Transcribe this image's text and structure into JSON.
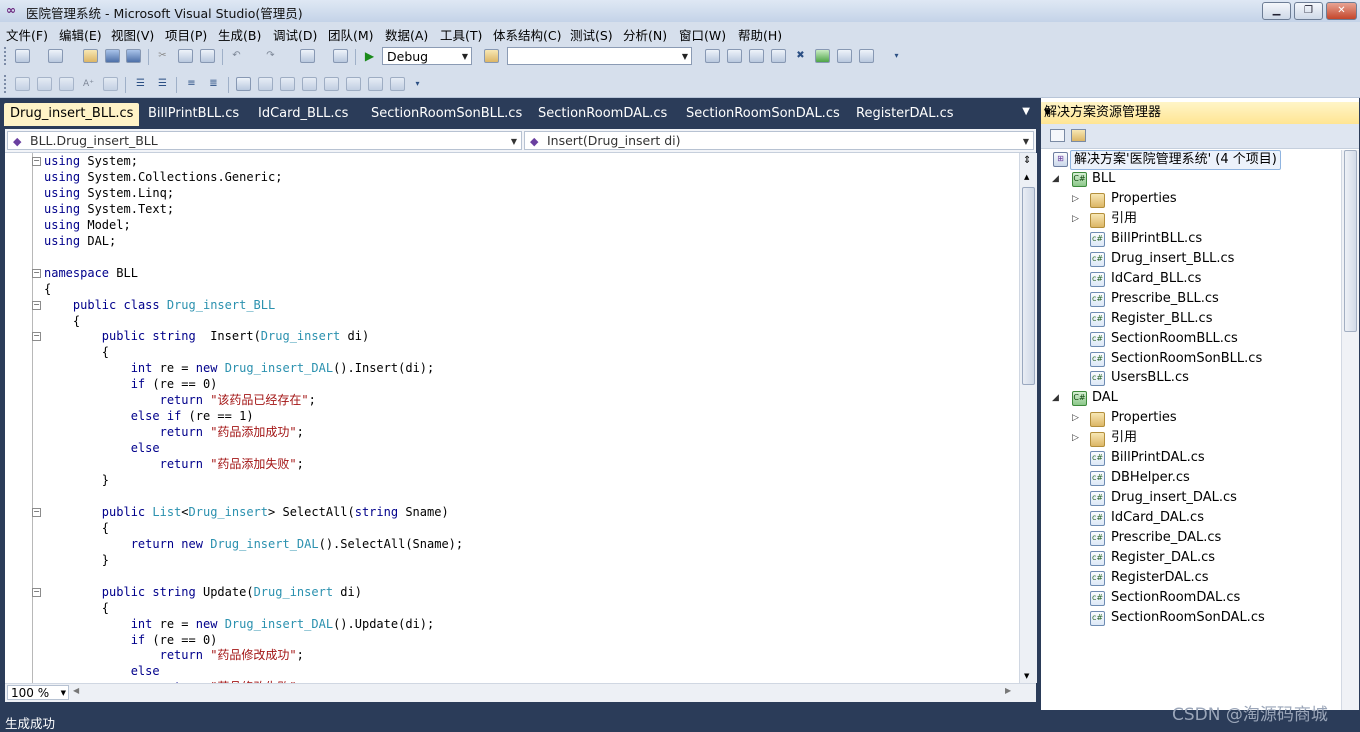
{
  "window": {
    "title": "医院管理系统 - Microsoft Visual Studio(管理员)",
    "buttons": [
      "▁",
      "❐",
      "✕"
    ]
  },
  "menu": [
    "文件(F)",
    "编辑(E)",
    "视图(V)",
    "项目(P)",
    "生成(B)",
    "调试(D)",
    "团队(M)",
    "数据(A)",
    "工具(T)",
    "体系结构(C)",
    "测试(S)",
    "分析(N)",
    "窗口(W)",
    "帮助(H)"
  ],
  "toolbar": {
    "configuration": "Debug",
    "platform": "",
    "start_icon": "play-icon"
  },
  "tabs": [
    "Drug_insert_BLL.cs",
    "BillPrintBLL.cs",
    "IdCard_BLL.cs",
    "SectionRoomSonBLL.cs",
    "SectionRoomDAL.cs",
    "SectionRoomSonDAL.cs",
    "RegisterDAL.cs"
  ],
  "navigation": {
    "type": "BLL.Drug_insert_BLL",
    "member": "Insert(Drug_insert di)"
  },
  "code_lines": [
    "using System;",
    "using System.Collections.Generic;",
    "using System.Linq;",
    "using System.Text;",
    "using Model;",
    "using DAL;",
    "",
    "namespace BLL",
    "{",
    "    public class Drug_insert_BLL",
    "    {",
    "        public string  Insert(Drug_insert di)",
    "        {",
    "            int re = new Drug_insert_DAL().Insert(di);",
    "            if (re == 0)",
    "                return \"该药品已经存在\";",
    "            else if (re == 1)",
    "                return \"药品添加成功\";",
    "            else",
    "                return \"药品添加失败\";",
    "        }",
    "",
    "        public List<Drug_insert> SelectAll(string Sname)",
    "        {",
    "            return new Drug_insert_DAL().SelectAll(Sname);",
    "        }",
    "",
    "        public string Update(Drug_insert di)",
    "        {",
    "            int re = new Drug_insert_DAL().Update(di);",
    "            if (re == 0)",
    "                return \"药品修改成功\";",
    "            else",
    "                return \"药品修改失败\";"
  ],
  "editor": {
    "zoom": "100 %"
  },
  "status": "生成成功",
  "solution_explorer": {
    "title": "解决方案资源管理器",
    "solution": "解决方案'医院管理系统' (4 个项目)",
    "projects": [
      {
        "name": "BLL",
        "folders": [
          "Properties",
          "引用"
        ],
        "files": [
          "BillPrintBLL.cs",
          "Drug_insert_BLL.cs",
          "IdCard_BLL.cs",
          "Prescribe_BLL.cs",
          "Register_BLL.cs",
          "SectionRoomBLL.cs",
          "SectionRoomSonBLL.cs",
          "UsersBLL.cs"
        ]
      },
      {
        "name": "DAL",
        "folders": [
          "Properties",
          "引用"
        ],
        "files": [
          "BillPrintDAL.cs",
          "DBHelper.cs",
          "Drug_insert_DAL.cs",
          "IdCard_DAL.cs",
          "Prescribe_DAL.cs",
          "Register_DAL.cs",
          "RegisterDAL.cs",
          "SectionRoomDAL.cs",
          "SectionRoomSonDAL.cs"
        ]
      }
    ]
  },
  "watermark": "CSDN @淘源码商城"
}
